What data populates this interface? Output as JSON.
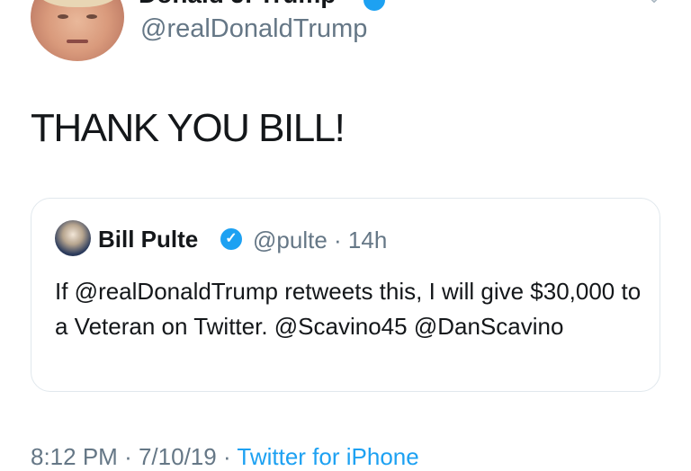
{
  "author": {
    "display_name": "Donald J. Trump",
    "handle": "@realDonaldTrump",
    "verified": true
  },
  "tweet": {
    "text": "THANK YOU BILL!"
  },
  "quoted_tweet": {
    "display_name": "Bill Pulte",
    "handle": "@pulte",
    "separator": "·",
    "age": "14h",
    "verified": true,
    "text": "If @realDonaldTrump retweets this, I will give $30,000 to a Veteran on Twitter. @Scavino45 @DanScavino"
  },
  "footer": {
    "time": "8:12 PM",
    "date": "7/10/19",
    "separator": "·",
    "source": "Twitter for iPhone"
  },
  "icons": {
    "verified": "verified-badge-icon",
    "more": "chevron-down-icon"
  },
  "colors": {
    "text": "#14171a",
    "secondary": "#657786",
    "accent": "#1da1f2",
    "border": "#e1e8ed"
  }
}
